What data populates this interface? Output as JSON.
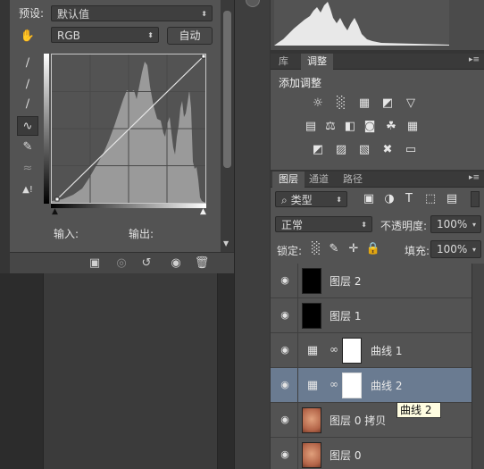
{
  "properties": {
    "preset_label": "预设:",
    "preset_value": "默认值",
    "channel_value": "RGB",
    "auto_button": "自动",
    "input_label": "输入:",
    "output_label": "输出:"
  },
  "adjustments": {
    "tabs": [
      "库",
      "调整"
    ],
    "active_tab": "调整",
    "heading": "添加调整"
  },
  "layers": {
    "tabs": [
      "图层",
      "通道",
      "路径"
    ],
    "active_tab": "图层",
    "filter_kind": "类型",
    "blend_mode": "正常",
    "opacity_label": "不透明度:",
    "opacity_value": "100%",
    "lock_label": "锁定:",
    "fill_label": "填充:",
    "fill_value": "100%",
    "items": [
      {
        "name": "图层 2",
        "kind": "fill",
        "thumb_color": "#000000",
        "selected": false
      },
      {
        "name": "图层 1",
        "kind": "fill",
        "thumb_color": "#000000",
        "selected": false
      },
      {
        "name": "曲线 1",
        "kind": "curves",
        "thumb_color": "#ffffff",
        "selected": false
      },
      {
        "name": "曲线 2",
        "kind": "curves",
        "thumb_color": "#ffffff",
        "selected": true
      },
      {
        "name": "图层 0 拷贝",
        "kind": "photo",
        "thumb_color": "#c97b5a",
        "selected": false
      },
      {
        "name": "图层 0",
        "kind": "photo",
        "thumb_color": "#c97b5a",
        "selected": false
      }
    ],
    "tooltip": "曲线 2"
  },
  "colors": {
    "panel_bg": "#535353",
    "selected_row": "#6a7b91",
    "histogram_fill": "#9a9a9a"
  }
}
